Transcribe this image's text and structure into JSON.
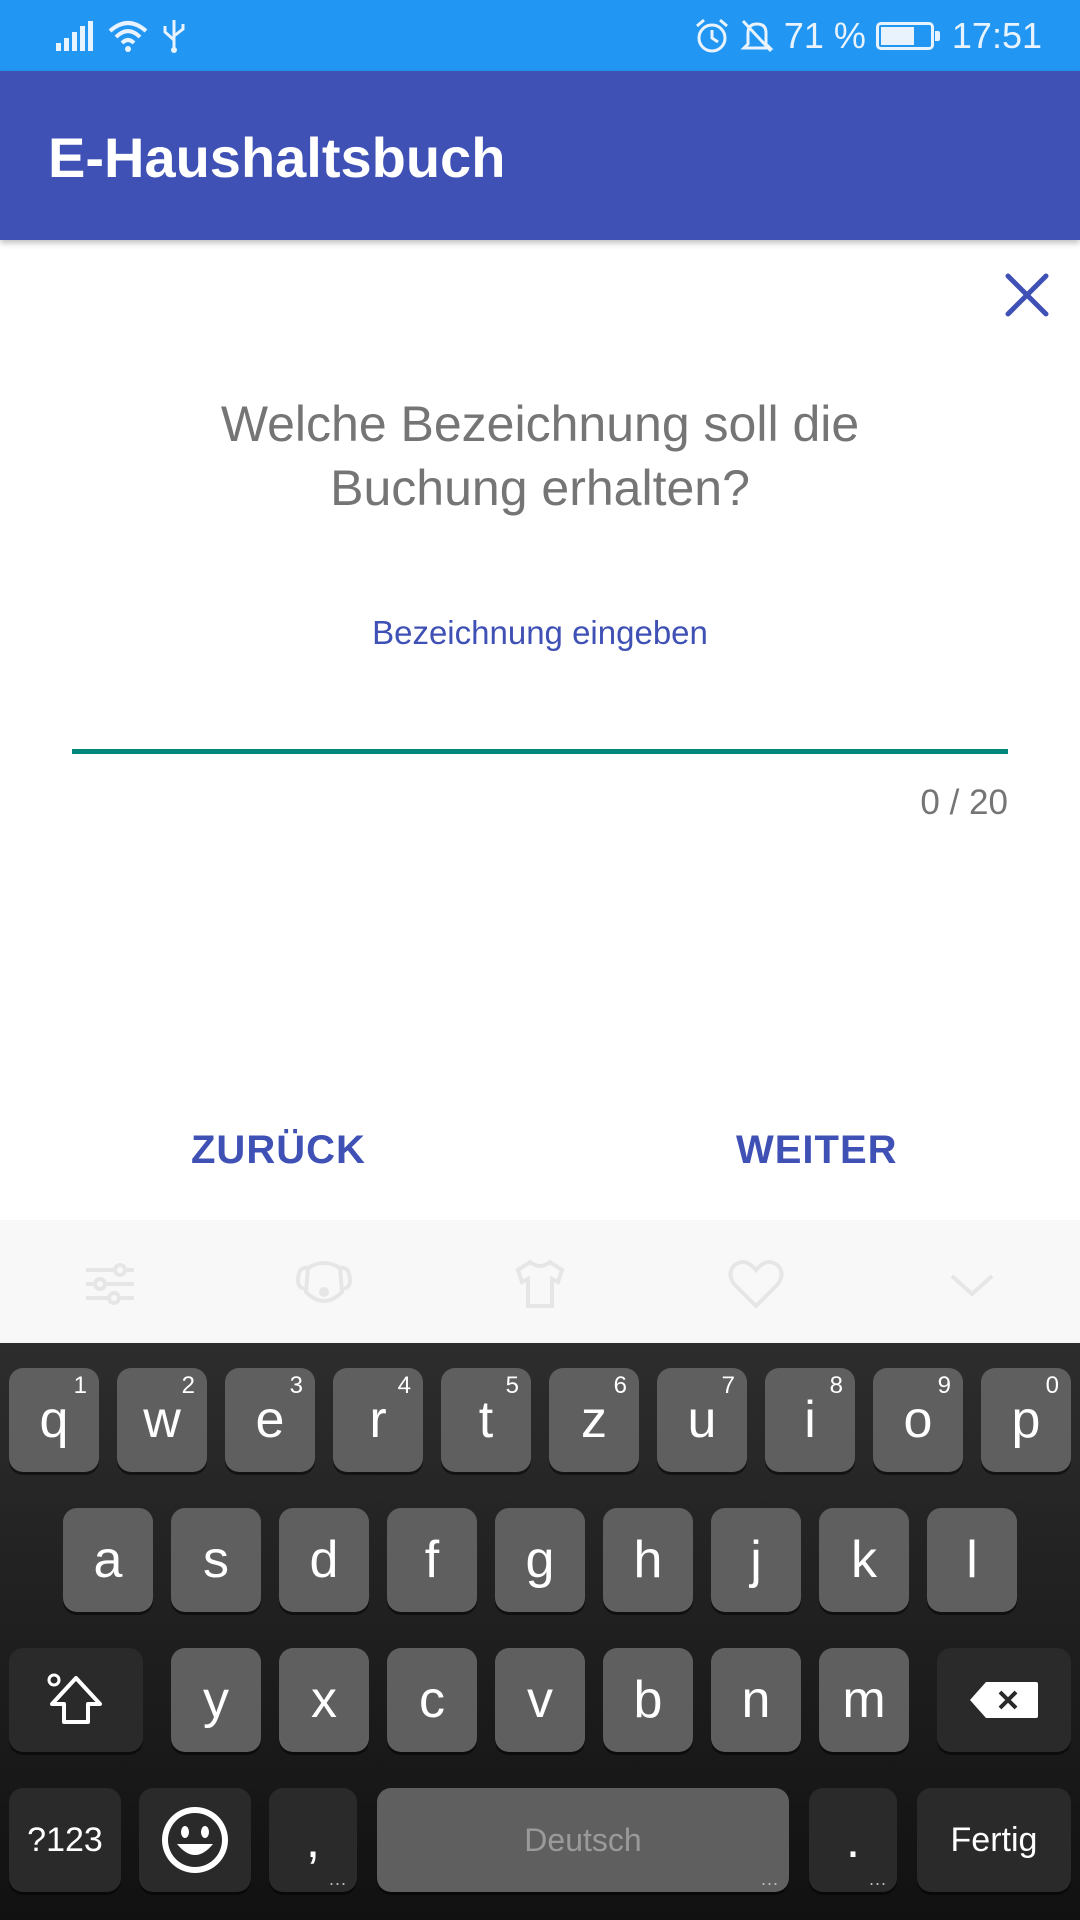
{
  "status_bar": {
    "battery_percent": "71 %",
    "battery_level": 0.71,
    "time": "17:51",
    "icons": [
      "signal-icon",
      "wifi-icon",
      "usb-icon",
      "alarm-icon",
      "notifications-off-icon",
      "battery-charging-icon"
    ]
  },
  "app_bar": {
    "title": "E-Haushaltsbuch"
  },
  "dialog": {
    "close_icon": "close-icon",
    "question_line1": "Welche Bezeichnung soll die",
    "question_line2": "Buchung erhalten?",
    "input_label": "Bezeichnung eingeben",
    "input_value": "",
    "counter": "0 / 20",
    "back_label": "ZURÜCK",
    "next_label": "WEITER"
  },
  "keyboard_toolbar": {
    "icons": [
      "settings-sliders-icon",
      "sticker-dog-icon",
      "theme-shirt-icon",
      "favorite-heart-icon",
      "collapse-chevron-icon"
    ]
  },
  "keyboard": {
    "row1": [
      {
        "key": "q",
        "hint": "1"
      },
      {
        "key": "w",
        "hint": "2"
      },
      {
        "key": "e",
        "hint": "3"
      },
      {
        "key": "r",
        "hint": "4"
      },
      {
        "key": "t",
        "hint": "5"
      },
      {
        "key": "z",
        "hint": "6"
      },
      {
        "key": "u",
        "hint": "7"
      },
      {
        "key": "i",
        "hint": "8"
      },
      {
        "key": "o",
        "hint": "9"
      },
      {
        "key": "p",
        "hint": "0"
      }
    ],
    "row2": [
      "a",
      "s",
      "d",
      "f",
      "g",
      "h",
      "j",
      "k",
      "l"
    ],
    "row3": [
      "y",
      "x",
      "c",
      "v",
      "b",
      "n",
      "m"
    ],
    "symbols_label": "?123",
    "comma": ",",
    "space_label": "Deutsch",
    "period": ".",
    "done_label": "Fertig"
  },
  "colors": {
    "status_bar": "#2196F3",
    "app_bar": "#3F51B5",
    "accent": "#3F51B5",
    "input_underline": "#00897B",
    "secondary_text": "#757575"
  }
}
